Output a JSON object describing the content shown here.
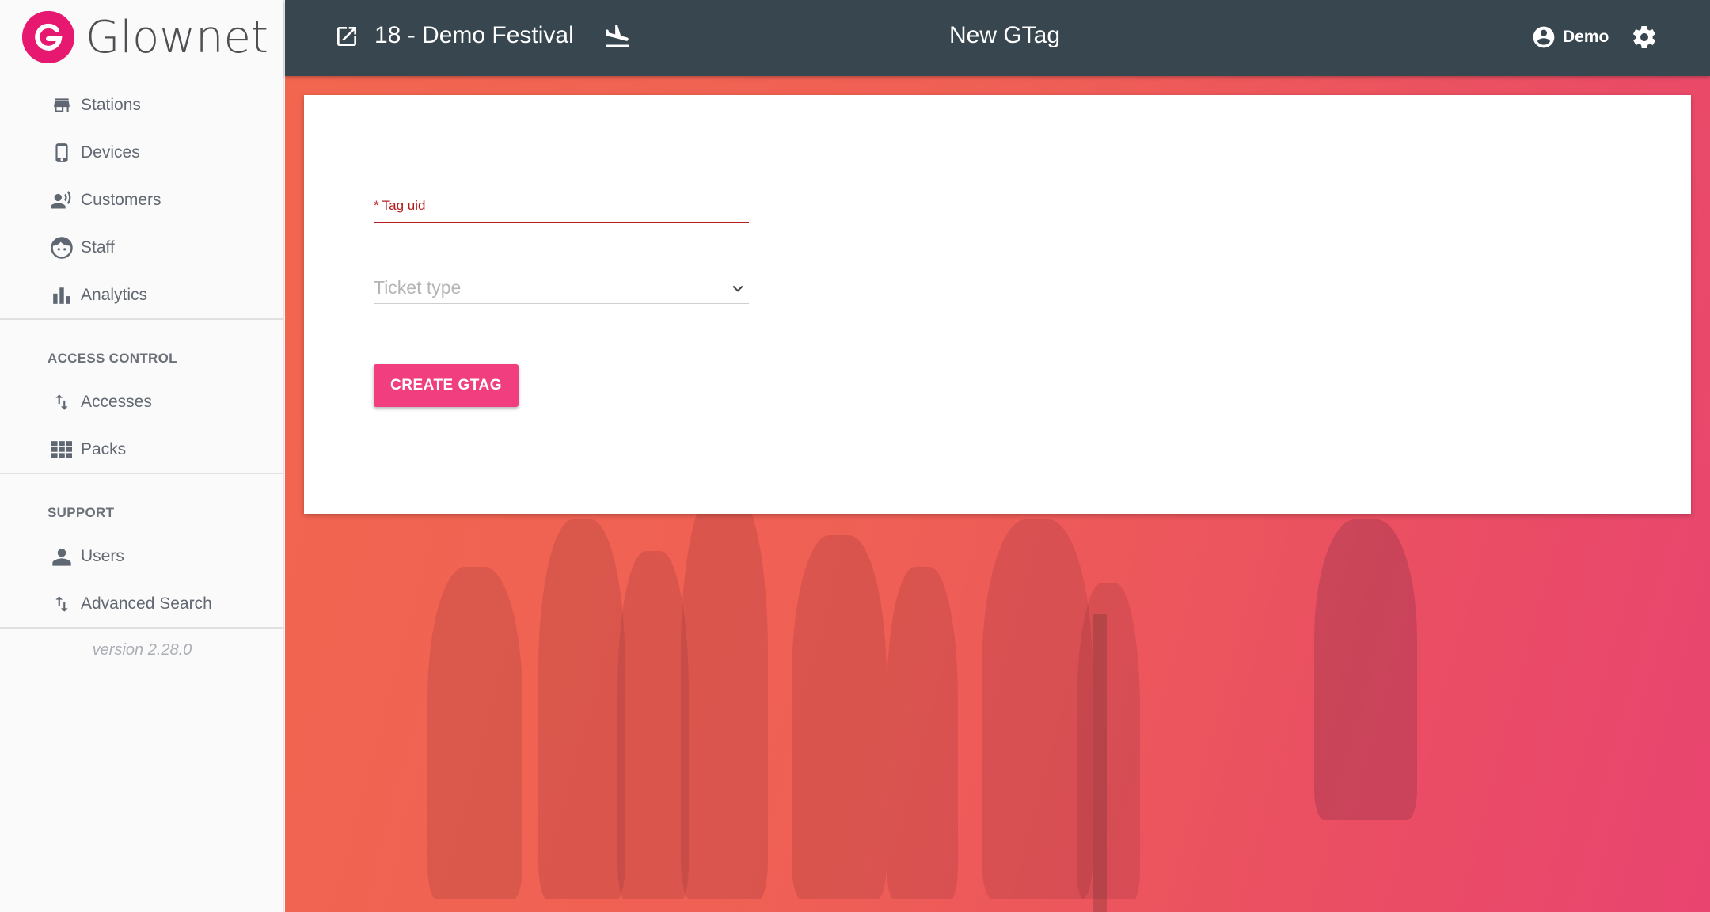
{
  "brand": {
    "name": "Glownet",
    "accent": "#e6186f"
  },
  "sidebar": {
    "main_items": [
      {
        "label": "Stations",
        "icon": "store-icon"
      },
      {
        "label": "Devices",
        "icon": "phone-icon"
      },
      {
        "label": "Customers",
        "icon": "customers-icon"
      },
      {
        "label": "Staff",
        "icon": "face-icon"
      },
      {
        "label": "Analytics",
        "icon": "bar-chart-icon"
      }
    ],
    "access_control": {
      "title": "ACCESS CONTROL",
      "items": [
        {
          "label": "Accesses",
          "icon": "swap-vertical-icon"
        },
        {
          "label": "Packs",
          "icon": "grid-icon"
        }
      ]
    },
    "support": {
      "title": "SUPPORT",
      "items": [
        {
          "label": "Users",
          "icon": "person-icon"
        },
        {
          "label": "Advanced Search",
          "icon": "swap-vertical-icon"
        }
      ]
    },
    "version": "version 2.28.0"
  },
  "topbar": {
    "event_name": "18 - Demo Festival",
    "page_title": "New GTag",
    "user_name": "Demo",
    "background": "#38474f"
  },
  "form": {
    "tag_uid": {
      "required_mark": "*",
      "label": "Tag uid",
      "value": ""
    },
    "ticket_type": {
      "placeholder": "Ticket type",
      "selected": ""
    },
    "submit_label": "CREATE GTAG",
    "submit_color": "#f03e7e",
    "error_color": "#b71c1c"
  }
}
